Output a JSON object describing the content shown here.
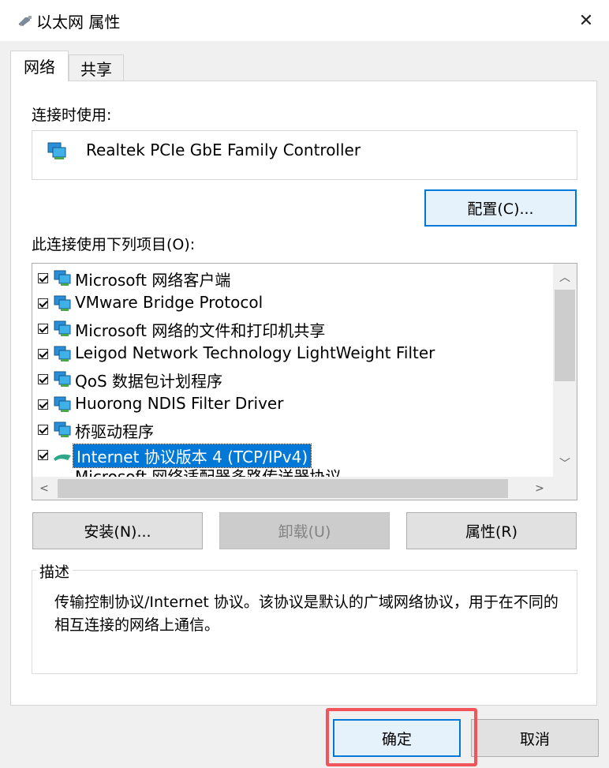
{
  "window": {
    "title": "以太网 属性",
    "close_glyph": "✕"
  },
  "tabs": [
    {
      "label": "网络",
      "active": true
    },
    {
      "label": "共享",
      "active": false
    }
  ],
  "connect_using": {
    "label": "连接时使用:",
    "adapter": "Realtek PCIe GbE Family Controller",
    "configure_button": "配置(C)..."
  },
  "items_section": {
    "label": "此连接使用下列项目(O):",
    "items": [
      {
        "label": "Microsoft 网络客户端",
        "checked": true,
        "icon": "network-client-icon"
      },
      {
        "label": "VMware Bridge Protocol",
        "checked": true,
        "icon": "network-service-icon"
      },
      {
        "label": "Microsoft 网络的文件和打印机共享",
        "checked": true,
        "icon": "network-service-icon"
      },
      {
        "label": "Leigod Network Technology LightWeight Filter",
        "checked": true,
        "icon": "network-service-icon"
      },
      {
        "label": "QoS 数据包计划程序",
        "checked": true,
        "icon": "network-service-icon"
      },
      {
        "label": "Huorong NDIS Filter Driver",
        "checked": true,
        "icon": "network-service-icon"
      },
      {
        "label": "桥驱动程序",
        "checked": true,
        "icon": "network-service-icon"
      },
      {
        "label": "Internet 协议版本 4 (TCP/IPv4)",
        "checked": true,
        "icon": "protocol-icon",
        "selected": true
      },
      {
        "label": "Microsoft 网络适配器多路传送器协议",
        "checked": false,
        "icon": "protocol-icon"
      }
    ]
  },
  "action_buttons": {
    "install": "安装(N)...",
    "uninstall": "卸载(U)",
    "properties": "属性(R)"
  },
  "description": {
    "legend": "描述",
    "text": "传输控制协议/Internet 协议。该协议是默认的广域网络协议，用于在不同的相互连接的网络上通信。"
  },
  "footer": {
    "ok": "确定",
    "cancel": "取消"
  },
  "colors": {
    "accent": "#0078d7",
    "highlight_frame": "#f2545b"
  }
}
